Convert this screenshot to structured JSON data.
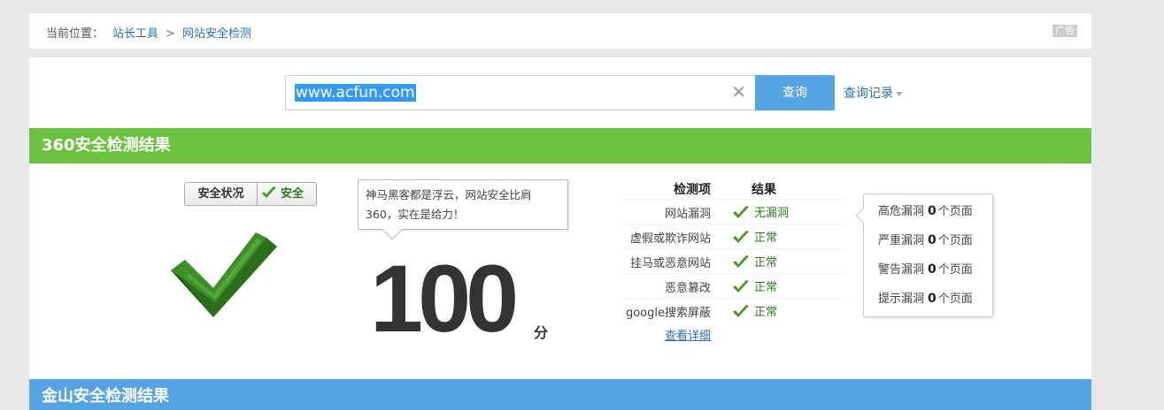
{
  "breadcrumb": {
    "prefix": "当前位置：",
    "items": [
      "站长工具",
      "网站安全检测"
    ],
    "separator": ">",
    "ad": "广告"
  },
  "search": {
    "value": "www.acfun.com",
    "clear_icon": "close-icon",
    "button_label": "查询",
    "history_label": "查询记录"
  },
  "section_360": {
    "title": "360安全检测结果",
    "status_label": "安全状况",
    "status_value": "安全",
    "bubble_text": "神马黑客都是浮云，网站安全比肩360，实在是给力！",
    "score": "100",
    "score_unit": "分",
    "table": {
      "col_item": "检测项",
      "col_result": "结果",
      "rows": [
        {
          "item": "网站漏洞",
          "result": "无漏洞"
        },
        {
          "item": "虚假或欺诈网站",
          "result": "正常"
        },
        {
          "item": "挂马或恶意网站",
          "result": "正常"
        },
        {
          "item": "恶意篡改",
          "result": "正常"
        },
        {
          "item": "google搜索屏蔽",
          "result": "正常"
        }
      ],
      "detail_link": "查看详细"
    },
    "vulnerabilities": [
      {
        "label": "高危漏洞",
        "count": "0",
        "unit": "个页面"
      },
      {
        "label": "严重漏洞",
        "count": "0",
        "unit": "个页面"
      },
      {
        "label": "警告漏洞",
        "count": "0",
        "unit": "个页面"
      },
      {
        "label": "提示漏洞",
        "count": "0",
        "unit": "个页面"
      }
    ]
  },
  "section_kingsoft": {
    "title": "金山安全检测结果"
  },
  "colors": {
    "green_header": "#6ac23e",
    "blue_header": "#55a4e3",
    "link": "#2a6fb5",
    "ok_text": "#2b7a1e"
  }
}
